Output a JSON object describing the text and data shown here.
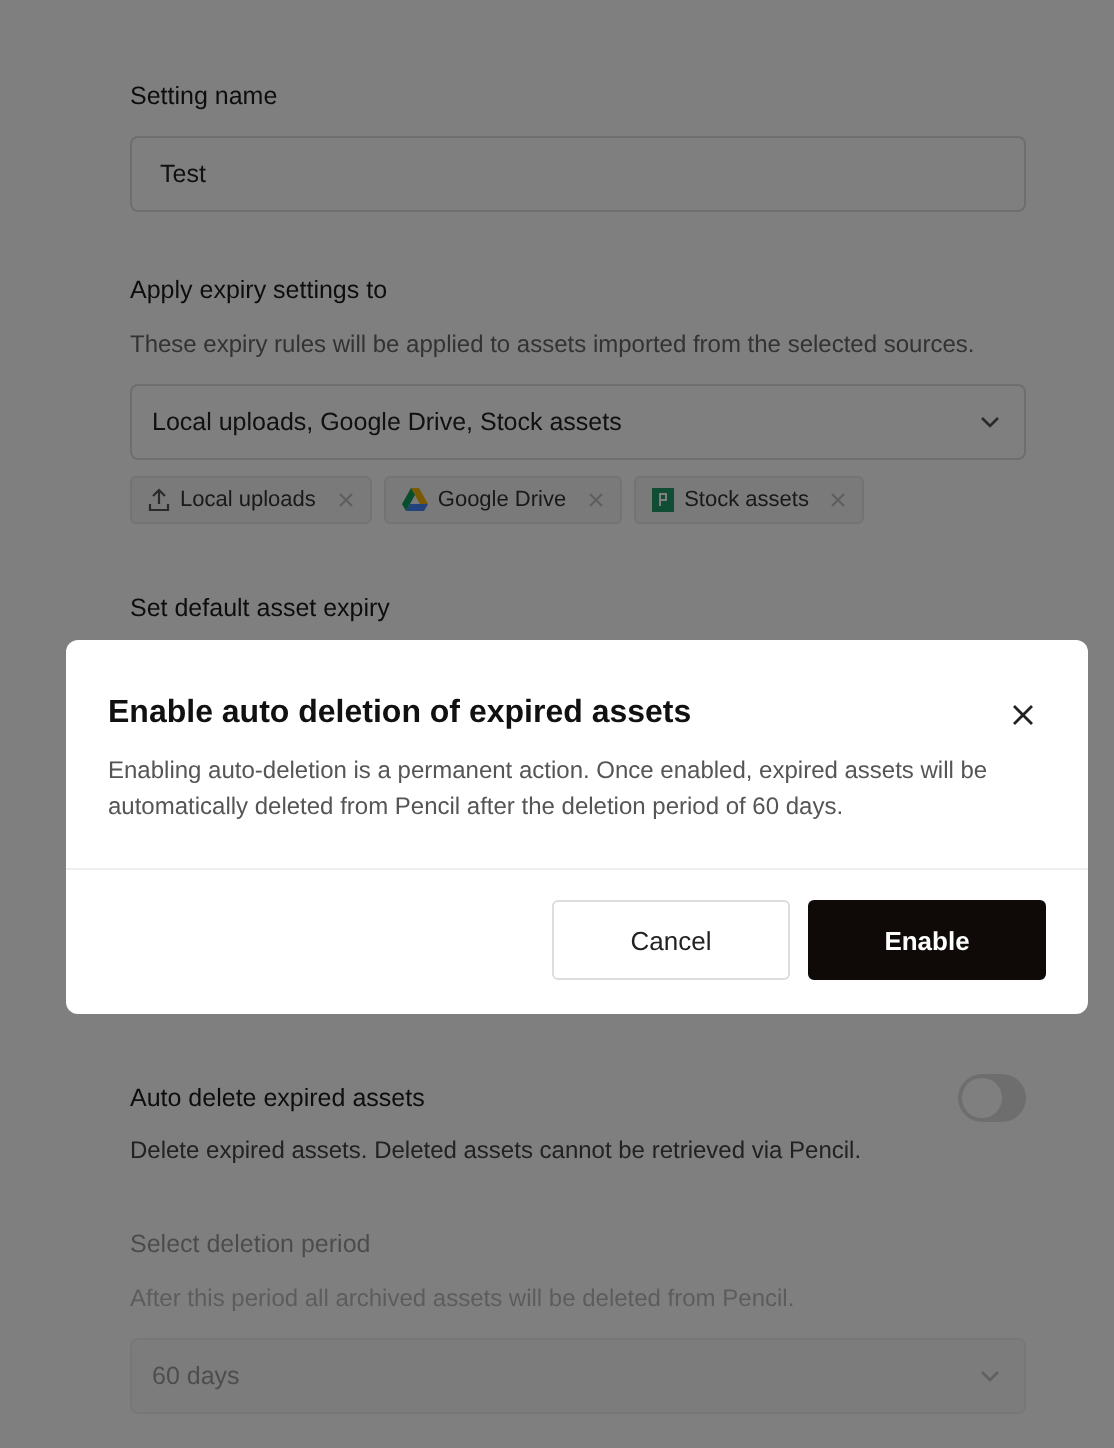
{
  "form": {
    "setting_name": {
      "label": "Setting name",
      "value": "Test"
    },
    "apply_to": {
      "label": "Apply expiry settings to",
      "description": "These expiry rules will be applied to assets imported from the selected sources.",
      "value": "Local uploads, Google Drive, Stock assets",
      "chips": [
        {
          "kind": "upload",
          "label": "Local uploads"
        },
        {
          "kind": "drive",
          "label": "Google Drive"
        },
        {
          "kind": "stock",
          "label": "Stock assets"
        }
      ]
    },
    "default_expiry": {
      "label": "Set default asset expiry"
    },
    "auto_delete": {
      "label": "Auto delete expired assets",
      "description": "Delete expired assets. Deleted assets cannot be retrieved via Pencil.",
      "on": false
    },
    "deletion_period": {
      "label": "Select deletion period",
      "description": "After this period all archived assets will be deleted from Pencil.",
      "value": "60 days",
      "disabled": true
    }
  },
  "dialog": {
    "title": "Enable auto deletion of expired assets",
    "message": "Enabling auto-deletion is a permanent action. Once enabled, expired assets will be automatically deleted from Pencil after the deletion period of 60 days.",
    "buttons": [
      "Cancel",
      "Enable"
    ]
  }
}
